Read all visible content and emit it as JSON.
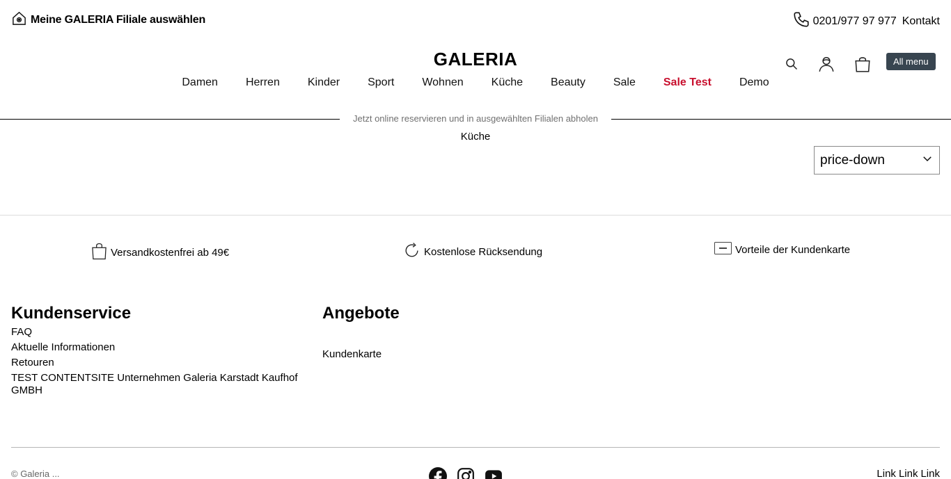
{
  "header": {
    "store_select_label": "Meine GALERIA Filiale auswählen",
    "phone": "0201/977 97 977",
    "contact_label": "Kontakt",
    "logo": "GALERIA",
    "all_menu_label": "All menu"
  },
  "nav": {
    "items": [
      {
        "label": "Damen"
      },
      {
        "label": "Herren"
      },
      {
        "label": "Kinder"
      },
      {
        "label": "Sport"
      },
      {
        "label": "Wohnen"
      },
      {
        "label": "Küche"
      },
      {
        "label": "Beauty"
      },
      {
        "label": "Sale"
      },
      {
        "label": "Sale Test"
      },
      {
        "label": "Demo"
      }
    ]
  },
  "promo": {
    "text": "Jetzt online reservieren und in ausgewählten Filialen abholen"
  },
  "breadcrumb": "Küche",
  "sort": {
    "selected": "price-down"
  },
  "benefits": [
    {
      "label": "Versandkostenfrei ab 49€",
      "icon": "shopping-bag-icon"
    },
    {
      "label": "Kostenlose Rücksendung",
      "icon": "refresh-icon"
    },
    {
      "label": "Vorteile der Kundenkarte",
      "icon": "card-icon"
    }
  ],
  "footer": {
    "kundenservice": {
      "title": "Kundenservice",
      "links": [
        "FAQ",
        "Aktuelle Informationen",
        "Retouren",
        "TEST CONTENTSITE Unternehmen Galeria Karstadt Kaufhof GMBH"
      ]
    },
    "angebote": {
      "title": "Angebote",
      "links": [
        "Kundenkarte"
      ]
    },
    "copyright": "© Galeria ...",
    "bottom_links": [
      "Link",
      "Link",
      "Link"
    ]
  },
  "colors": {
    "accent_red": "#c8102e",
    "menu_button": "#384550"
  },
  "icons": [
    "home-location-icon",
    "phone-icon",
    "search-icon",
    "user-icon",
    "cart-icon",
    "chevron-down-icon",
    "facebook-icon",
    "instagram-icon",
    "youtube-icon"
  ]
}
